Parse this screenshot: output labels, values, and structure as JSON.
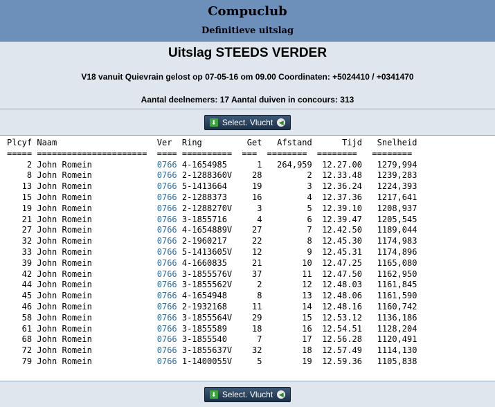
{
  "site": {
    "title": "Compuclub",
    "subtitle": "Definitieve uitslag"
  },
  "race": {
    "title": "Uitslag STEEDS VERDER",
    "info": "V18 vanuit Quievrain gelost op 07-05-16 om 09.00 Coordinaten: +5024410 / +0341470",
    "participants": "Aantal deelnemers: 17 Aantal duiven in concours: 313"
  },
  "buttons": {
    "select_label": "Select. Vlucht",
    "download_icon": "download-icon",
    "arrow_icon": "arrow-left-icon"
  },
  "table": {
    "headers": [
      "Plcyf",
      "Naam",
      "Ver",
      "Ring",
      "Get",
      "Afstand",
      "Tijd",
      "Snelheid"
    ],
    "rows": [
      {
        "plcyf": "2",
        "naam": "John Romein",
        "ver": "0766",
        "ring": "4-1654985",
        "get": "1",
        "afstand": "264,959",
        "tijd": "12.27.00",
        "snelheid": "1279,994"
      },
      {
        "plcyf": "8",
        "naam": "John Romein",
        "ver": "0766",
        "ring": "2-1288360V",
        "get": "28",
        "afstand": "2",
        "tijd": "12.33.48",
        "snelheid": "1239,283"
      },
      {
        "plcyf": "13",
        "naam": "John Romein",
        "ver": "0766",
        "ring": "5-1413664",
        "get": "19",
        "afstand": "3",
        "tijd": "12.36.24",
        "snelheid": "1224,393"
      },
      {
        "plcyf": "15",
        "naam": "John Romein",
        "ver": "0766",
        "ring": "2-1288373",
        "get": "16",
        "afstand": "4",
        "tijd": "12.37.36",
        "snelheid": "1217,641"
      },
      {
        "plcyf": "19",
        "naam": "John Romein",
        "ver": "0766",
        "ring": "2-1288270V",
        "get": "3",
        "afstand": "5",
        "tijd": "12.39.10",
        "snelheid": "1208,937"
      },
      {
        "plcyf": "21",
        "naam": "John Romein",
        "ver": "0766",
        "ring": "3-1855716",
        "get": "4",
        "afstand": "6",
        "tijd": "12.39.47",
        "snelheid": "1205,545"
      },
      {
        "plcyf": "27",
        "naam": "John Romein",
        "ver": "0766",
        "ring": "4-1654889V",
        "get": "27",
        "afstand": "7",
        "tijd": "12.42.50",
        "snelheid": "1189,044"
      },
      {
        "plcyf": "32",
        "naam": "John Romein",
        "ver": "0766",
        "ring": "2-1960217",
        "get": "22",
        "afstand": "8",
        "tijd": "12.45.30",
        "snelheid": "1174,983"
      },
      {
        "plcyf": "33",
        "naam": "John Romein",
        "ver": "0766",
        "ring": "5-1413605V",
        "get": "12",
        "afstand": "9",
        "tijd": "12.45.31",
        "snelheid": "1174,896"
      },
      {
        "plcyf": "39",
        "naam": "John Romein",
        "ver": "0766",
        "ring": "4-1660835",
        "get": "21",
        "afstand": "10",
        "tijd": "12.47.25",
        "snelheid": "1165,080"
      },
      {
        "plcyf": "42",
        "naam": "John Romein",
        "ver": "0766",
        "ring": "3-1855576V",
        "get": "37",
        "afstand": "11",
        "tijd": "12.47.50",
        "snelheid": "1162,950"
      },
      {
        "plcyf": "44",
        "naam": "John Romein",
        "ver": "0766",
        "ring": "3-1855562V",
        "get": "2",
        "afstand": "12",
        "tijd": "12.48.03",
        "snelheid": "1161,845"
      },
      {
        "plcyf": "45",
        "naam": "John Romein",
        "ver": "0766",
        "ring": "4-1654948",
        "get": "8",
        "afstand": "13",
        "tijd": "12.48.06",
        "snelheid": "1161,590"
      },
      {
        "plcyf": "46",
        "naam": "John Romein",
        "ver": "0766",
        "ring": "2-1932168",
        "get": "11",
        "afstand": "14",
        "tijd": "12.48.16",
        "snelheid": "1160,742"
      },
      {
        "plcyf": "58",
        "naam": "John Romein",
        "ver": "0766",
        "ring": "3-1855564V",
        "get": "29",
        "afstand": "15",
        "tijd": "12.53.12",
        "snelheid": "1136,186"
      },
      {
        "plcyf": "61",
        "naam": "John Romein",
        "ver": "0766",
        "ring": "3-1855589",
        "get": "18",
        "afstand": "16",
        "tijd": "12.54.51",
        "snelheid": "1128,204"
      },
      {
        "plcyf": "68",
        "naam": "John Romein",
        "ver": "0766",
        "ring": "3-1855540",
        "get": "7",
        "afstand": "17",
        "tijd": "12.56.28",
        "snelheid": "1120,491"
      },
      {
        "plcyf": "72",
        "naam": "John Romein",
        "ver": "0766",
        "ring": "3-1855637V",
        "get": "32",
        "afstand": "18",
        "tijd": "12.57.49",
        "snelheid": "1114,130"
      },
      {
        "plcyf": "79",
        "naam": "John Romein",
        "ver": "0766",
        "ring": "1-1400055V",
        "get": "5",
        "afstand": "19",
        "tijd": "12.59.36",
        "snelheid": "1105,838"
      }
    ]
  }
}
